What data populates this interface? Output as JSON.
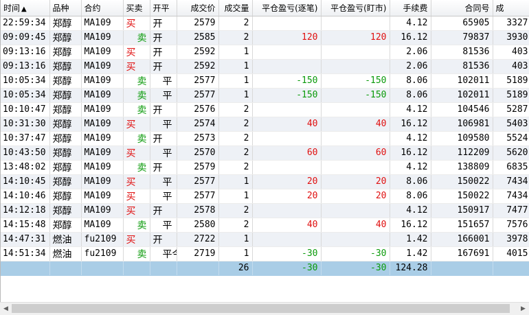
{
  "columns": [
    {
      "key": "time",
      "label": "时间",
      "sort": "▲",
      "align": "l"
    },
    {
      "key": "kind",
      "label": "品种",
      "align": "l"
    },
    {
      "key": "contract",
      "label": "合约",
      "align": "l"
    },
    {
      "key": "side",
      "label": "买卖",
      "align": "l"
    },
    {
      "key": "oc",
      "label": "开平",
      "align": "l"
    },
    {
      "key": "price",
      "label": "成交价",
      "align": "r"
    },
    {
      "key": "qty",
      "label": "成交量",
      "align": "r"
    },
    {
      "key": "pnl_close",
      "label": "平仓盈亏(逐笔)",
      "align": "r"
    },
    {
      "key": "pnl_mark",
      "label": "平仓盈亏(盯市)",
      "align": "r"
    },
    {
      "key": "fee",
      "label": "手续费",
      "align": "r"
    },
    {
      "key": "contract_no",
      "label": "合同号",
      "align": "r"
    },
    {
      "key": "trade_no",
      "label": "成",
      "align": "l"
    }
  ],
  "rows": [
    {
      "time": "22:59:34",
      "kind": "郑醇",
      "contract": "MA109",
      "side": "买",
      "oc": "开",
      "price": "2579",
      "qty": "2",
      "pnl_close": "",
      "pnl_mark": "",
      "fee": "4.12",
      "contract_no": "65905",
      "trade_no": "3327"
    },
    {
      "time": "09:09:45",
      "kind": "郑醇",
      "contract": "MA109",
      "side": "卖",
      "oc": "开",
      "price": "2585",
      "qty": "2",
      "pnl_close": "120",
      "pnl_mark": "120",
      "fee": "16.12",
      "contract_no": "79837",
      "trade_no": "3930"
    },
    {
      "time": "09:13:16",
      "kind": "郑醇",
      "contract": "MA109",
      "side": "买",
      "oc": "开",
      "price": "2592",
      "qty": "1",
      "pnl_close": "",
      "pnl_mark": "",
      "fee": "2.06",
      "contract_no": "81536",
      "trade_no": "403"
    },
    {
      "time": "09:13:16",
      "kind": "郑醇",
      "contract": "MA109",
      "side": "买",
      "oc": "开",
      "price": "2592",
      "qty": "1",
      "pnl_close": "",
      "pnl_mark": "",
      "fee": "2.06",
      "contract_no": "81536",
      "trade_no": "403"
    },
    {
      "time": "10:05:34",
      "kind": "郑醇",
      "contract": "MA109",
      "side": "卖",
      "oc": "平",
      "price": "2577",
      "qty": "1",
      "pnl_close": "-150",
      "pnl_mark": "-150",
      "fee": "8.06",
      "contract_no": "102011",
      "trade_no": "5189"
    },
    {
      "time": "10:05:34",
      "kind": "郑醇",
      "contract": "MA109",
      "side": "卖",
      "oc": "平",
      "price": "2577",
      "qty": "1",
      "pnl_close": "-150",
      "pnl_mark": "-150",
      "fee": "8.06",
      "contract_no": "102011",
      "trade_no": "5189"
    },
    {
      "time": "10:10:47",
      "kind": "郑醇",
      "contract": "MA109",
      "side": "卖",
      "oc": "开",
      "price": "2576",
      "qty": "2",
      "pnl_close": "",
      "pnl_mark": "",
      "fee": "4.12",
      "contract_no": "104546",
      "trade_no": "5287"
    },
    {
      "time": "10:31:30",
      "kind": "郑醇",
      "contract": "MA109",
      "side": "买",
      "oc": "平",
      "price": "2574",
      "qty": "2",
      "pnl_close": "40",
      "pnl_mark": "40",
      "fee": "16.12",
      "contract_no": "106981",
      "trade_no": "5403"
    },
    {
      "time": "10:37:47",
      "kind": "郑醇",
      "contract": "MA109",
      "side": "卖",
      "oc": "开",
      "price": "2573",
      "qty": "2",
      "pnl_close": "",
      "pnl_mark": "",
      "fee": "4.12",
      "contract_no": "109580",
      "trade_no": "5524"
    },
    {
      "time": "10:43:50",
      "kind": "郑醇",
      "contract": "MA109",
      "side": "买",
      "oc": "平",
      "price": "2570",
      "qty": "2",
      "pnl_close": "60",
      "pnl_mark": "60",
      "fee": "16.12",
      "contract_no": "112209",
      "trade_no": "5620"
    },
    {
      "time": "13:48:02",
      "kind": "郑醇",
      "contract": "MA109",
      "side": "卖",
      "oc": "开",
      "price": "2579",
      "qty": "2",
      "pnl_close": "",
      "pnl_mark": "",
      "fee": "4.12",
      "contract_no": "138809",
      "trade_no": "6835"
    },
    {
      "time": "14:10:45",
      "kind": "郑醇",
      "contract": "MA109",
      "side": "买",
      "oc": "平",
      "price": "2577",
      "qty": "1",
      "pnl_close": "20",
      "pnl_mark": "20",
      "fee": "8.06",
      "contract_no": "150022",
      "trade_no": "7434"
    },
    {
      "time": "14:10:46",
      "kind": "郑醇",
      "contract": "MA109",
      "side": "买",
      "oc": "平",
      "price": "2577",
      "qty": "1",
      "pnl_close": "20",
      "pnl_mark": "20",
      "fee": "8.06",
      "contract_no": "150022",
      "trade_no": "7434"
    },
    {
      "time": "14:12:18",
      "kind": "郑醇",
      "contract": "MA109",
      "side": "买",
      "oc": "开",
      "price": "2578",
      "qty": "2",
      "pnl_close": "",
      "pnl_mark": "",
      "fee": "4.12",
      "contract_no": "150917",
      "trade_no": "7477"
    },
    {
      "time": "14:15:48",
      "kind": "郑醇",
      "contract": "MA109",
      "side": "卖",
      "oc": "平",
      "price": "2580",
      "qty": "2",
      "pnl_close": "40",
      "pnl_mark": "40",
      "fee": "16.12",
      "contract_no": "151657",
      "trade_no": "7576"
    },
    {
      "time": "14:47:31",
      "kind": "燃油",
      "contract": "fu2109",
      "side": "买",
      "oc": "开",
      "price": "2722",
      "qty": "1",
      "pnl_close": "",
      "pnl_mark": "",
      "fee": "1.42",
      "contract_no": "166001",
      "trade_no": "3978"
    },
    {
      "time": "14:51:34",
      "kind": "燃油",
      "contract": "fu2109",
      "side": "卖",
      "oc": "平今",
      "price": "2719",
      "qty": "1",
      "pnl_close": "-30",
      "pnl_mark": "-30",
      "fee": "1.42",
      "contract_no": "167691",
      "trade_no": "4015"
    }
  ],
  "totals": {
    "qty": "26",
    "pnl_close": "-30",
    "pnl_mark": "-30",
    "fee": "124.28"
  },
  "scrollbar": {
    "left_arrow": "◀",
    "right_arrow": "▶"
  },
  "colors": {
    "buy": "#e01010",
    "sell": "#0a9a0a",
    "total_row_bg": "#a9cde6",
    "alt_row_bg": "#eef1f6"
  }
}
